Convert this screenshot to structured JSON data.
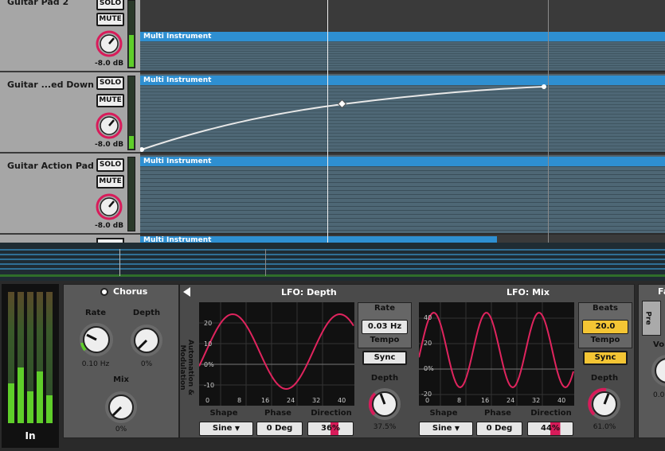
{
  "tracks": [
    {
      "name": "Guitar Pad 2",
      "solo": "SOLO",
      "mute": "MUTE",
      "volume": "-8.0 dB",
      "clip": "Multi Instrument",
      "meter_level": 0.5
    },
    {
      "name": "Guitar ...ed Down",
      "solo": "SOLO",
      "mute": "MUTE",
      "volume": "-8.0 dB",
      "clip": "Multi Instrument",
      "meter_level": 0.2
    },
    {
      "name": "Guitar Action Pad",
      "solo": "SOLO",
      "mute": "MUTE",
      "volume": "-8.0 dB",
      "clip": "Multi Instrument",
      "meter_level": 0.0
    },
    {
      "name": "",
      "solo": "",
      "mute": "",
      "volume": "",
      "clip": "Multi Instrument",
      "meter_level": 0.0
    }
  ],
  "input": {
    "label": "In"
  },
  "chorus": {
    "title": "Chorus",
    "rate_label": "Rate",
    "rate_value": "0.10 Hz",
    "depth_label": "Depth",
    "depth_value": "0%",
    "mix_label": "Mix",
    "mix_value": "0%"
  },
  "automation_label": "Automation & Modulation",
  "lfo_depth": {
    "title": "LFO: Depth",
    "y_ticks": [
      "20",
      "10",
      "0%",
      "-10"
    ],
    "x_ticks": [
      "0",
      "8",
      "16",
      "24",
      "32",
      "40"
    ],
    "rate_label": "Rate",
    "rate_value": "0.03 Hz",
    "tempo_label": "Tempo",
    "sync_label": "Sync",
    "depth_label": "Depth",
    "depth_value": "37.5%",
    "shape_label": "Shape",
    "shape_value": "Sine",
    "phase_label": "Phase",
    "phase_value": "0 Deg",
    "direction_label": "Direction",
    "direction_value": "36%"
  },
  "lfo_mix": {
    "title": "LFO: Mix",
    "y_ticks": [
      "40",
      "20",
      "0%",
      "-20"
    ],
    "x_ticks": [
      "0",
      "8",
      "16",
      "24",
      "32",
      "40"
    ],
    "beats_label": "Beats",
    "beats_value": "20.0",
    "tempo_label": "Tempo",
    "sync_label": "Sync",
    "depth_label": "Depth",
    "depth_value": "61.0%",
    "shape_label": "Shape",
    "shape_value": "Sine",
    "phase_label": "Phase",
    "phase_value": "0 Deg",
    "direction_label": "Direction",
    "direction_value": "44%"
  },
  "next_panel": {
    "title": "Fa",
    "tab": "Pre",
    "knob_label": "Vo",
    "knob_value": "0.0"
  },
  "colors": {
    "clip": "#2e8fd1",
    "curve": "#e0245e",
    "meter": "#5fce2a",
    "sync_active": "#f4c534",
    "panel": "#595959"
  }
}
